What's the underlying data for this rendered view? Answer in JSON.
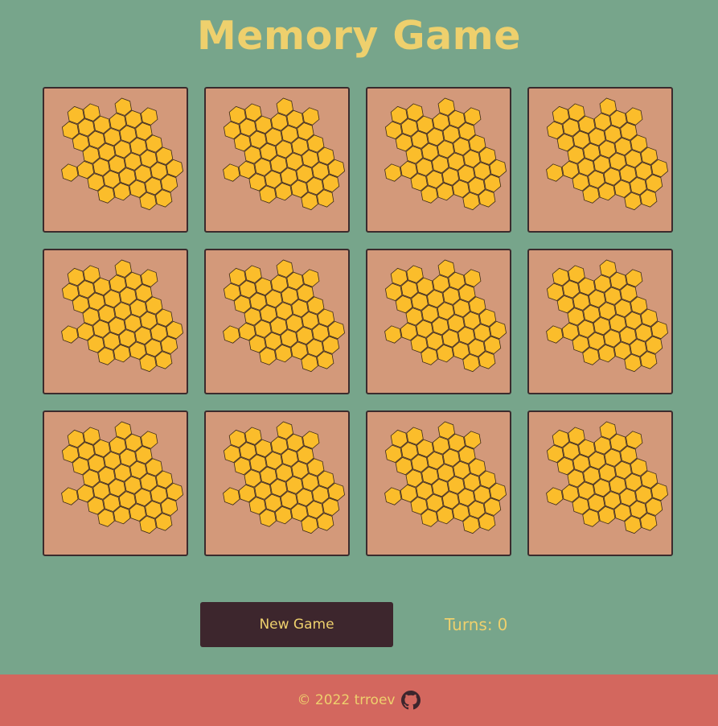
{
  "title": "Memory Game",
  "cards": [
    {
      "face": "honeycomb-icon",
      "state": "face-down"
    },
    {
      "face": "honeycomb-icon",
      "state": "face-down"
    },
    {
      "face": "honeycomb-icon",
      "state": "face-down"
    },
    {
      "face": "honeycomb-icon",
      "state": "face-down"
    },
    {
      "face": "honeycomb-icon",
      "state": "face-down"
    },
    {
      "face": "honeycomb-icon",
      "state": "face-down"
    },
    {
      "face": "honeycomb-icon",
      "state": "face-down"
    },
    {
      "face": "honeycomb-icon",
      "state": "face-down"
    },
    {
      "face": "honeycomb-icon",
      "state": "face-down"
    },
    {
      "face": "honeycomb-icon",
      "state": "face-down"
    },
    {
      "face": "honeycomb-icon",
      "state": "face-down"
    },
    {
      "face": "honeycomb-icon",
      "state": "face-down"
    }
  ],
  "controls": {
    "new_game_label": "New Game",
    "turns_label": "Turns:",
    "turns_value": "0"
  },
  "footer": {
    "copyright": "© 2022 trroev",
    "icon": "github-icon"
  },
  "colors": {
    "background": "#77a58b",
    "title": "#eed06d",
    "card_back": "#d3997a",
    "hex_fill": "#fbbd2b",
    "card_border": "#3b2b2d",
    "button": "#3d262d",
    "footer": "#d3675e"
  }
}
